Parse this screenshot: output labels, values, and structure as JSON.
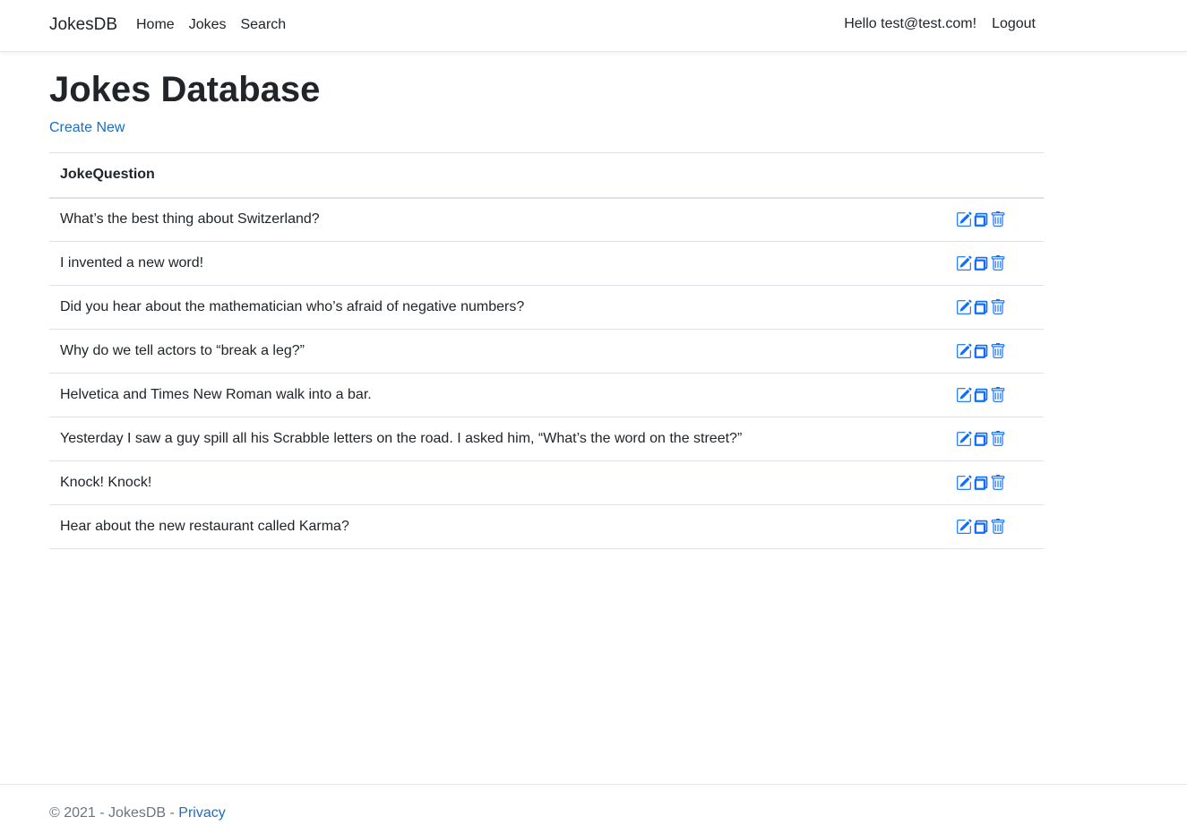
{
  "navbar": {
    "brand": "JokesDB",
    "links": [
      "Home",
      "Jokes",
      "Search"
    ],
    "greeting": "Hello test@test.com!",
    "logout": "Logout"
  },
  "page": {
    "title": "Jokes Database",
    "create_new": "Create New"
  },
  "table": {
    "header": "JokeQuestion",
    "rows": [
      "What’s the best thing about Switzerland?",
      "I invented a new word!",
      "Did you hear about the mathematician who’s afraid of negative numbers?",
      "Why do we tell actors to “break a leg?”",
      "Helvetica and Times New Roman walk into a bar.",
      "Yesterday I saw a guy spill all his Scrabble letters on the road. I asked him, “What’s the word on the street?”",
      "Knock! Knock!",
      "Hear about the new restaurant called Karma?"
    ],
    "row_icons": [
      "edit-icon",
      "details-icon",
      "trash-icon"
    ]
  },
  "footer": {
    "copyright": "© 2021 - JokesDB - ",
    "privacy": "Privacy"
  },
  "colors": {
    "link": "#1b6ec2",
    "icon": "#0d6efd",
    "text": "#212529",
    "muted": "#6c757d",
    "border": "#dee2e6"
  }
}
